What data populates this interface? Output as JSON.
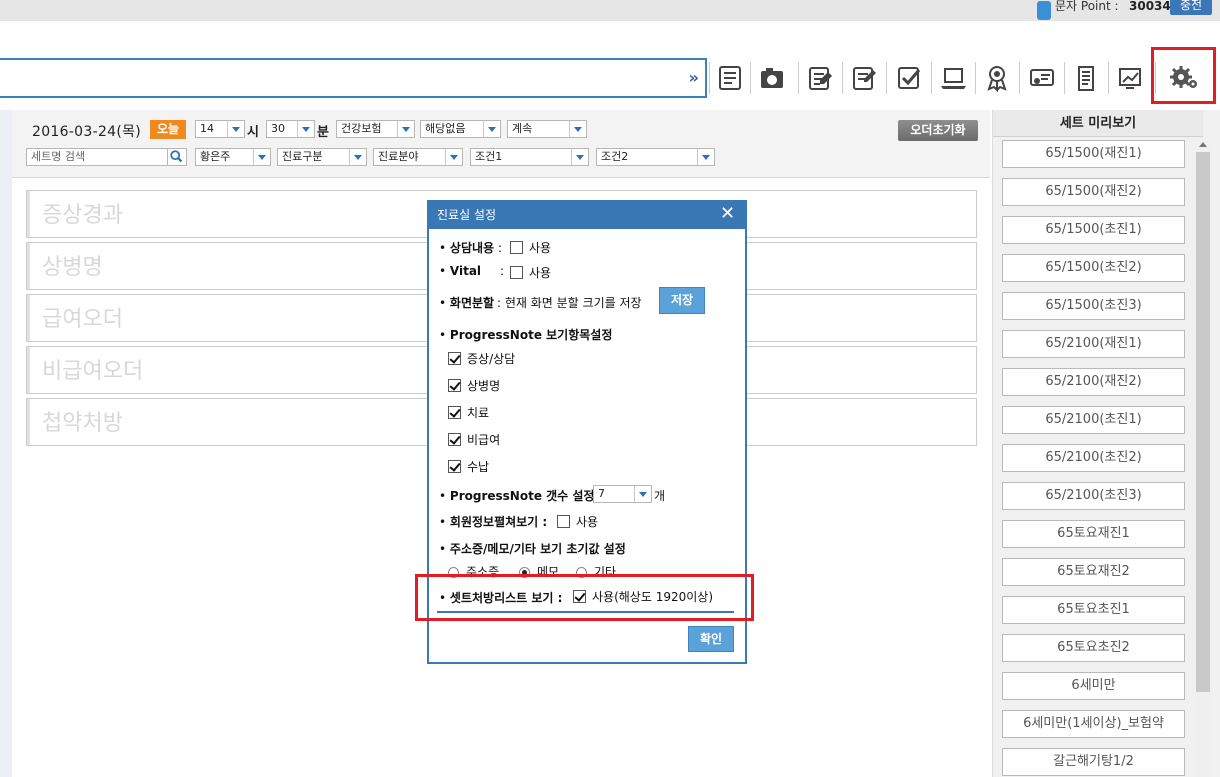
{
  "topbar": {
    "sms_label": "문자 Point :",
    "points": "30034",
    "charge_label": "충전"
  },
  "controls": {
    "date": "2016-03-24(목)",
    "today": "오늘",
    "hour": "14",
    "hour_unit": "시",
    "minute": "30",
    "minute_unit": "분",
    "insurance": "건강보험",
    "applicable": "해당없음",
    "continued": "계속",
    "reset": "오더초기화",
    "set_search_placeholder": "세트명 검색",
    "doctor": "황은주",
    "visit_type": "진료구분",
    "field": "진료분야",
    "cond1": "조건1",
    "cond2": "조건2"
  },
  "sections": [
    "증상경과",
    "상병명",
    "급여오더",
    "비급여오더",
    "첩약처방"
  ],
  "right_panel": {
    "title": "세트 미리보기",
    "items": [
      "65/1500(재진1)",
      "65/1500(재진2)",
      "65/1500(초진1)",
      "65/1500(초진2)",
      "65/1500(초진3)",
      "65/2100(재진1)",
      "65/2100(재진2)",
      "65/2100(초진1)",
      "65/2100(초진2)",
      "65/2100(초진3)",
      "65토요재진1",
      "65토요재진2",
      "65토요초진1",
      "65토요초진2",
      "6세미만",
      "6세미만(1세이상)_보험약",
      "갈근해기탕1/2"
    ]
  },
  "modal": {
    "title": "진료실 설정",
    "consult_label": "상담내용",
    "vital_label": "Vital",
    "use": "사용",
    "split_label": "화면분할",
    "split_desc": ": 현재 화면 분할 크기를 저장",
    "save": "저장",
    "pn_items_label": "ProgressNote 보기항목설정",
    "pn_items": [
      "증상/상담",
      "상병명",
      "치료",
      "비급여",
      "수납"
    ],
    "pn_count_label": "ProgressNote 갯수 설정 :",
    "pn_count": "7",
    "pn_count_unit": "개",
    "member_label": "회원정보펼쳐보기 :",
    "default_label": "주소증/메모/기타 보기 초기값 설정",
    "radio_options": [
      "주소증",
      "메모",
      "기타"
    ],
    "setlist_label": "셋트처방리스트 보기 :",
    "setlist_use": "사용(해상도 1920이상)",
    "ok": "확인"
  },
  "colors": {
    "accent": "#3a78b5",
    "highlight": "#e31d25",
    "today": "#f08a1e"
  }
}
